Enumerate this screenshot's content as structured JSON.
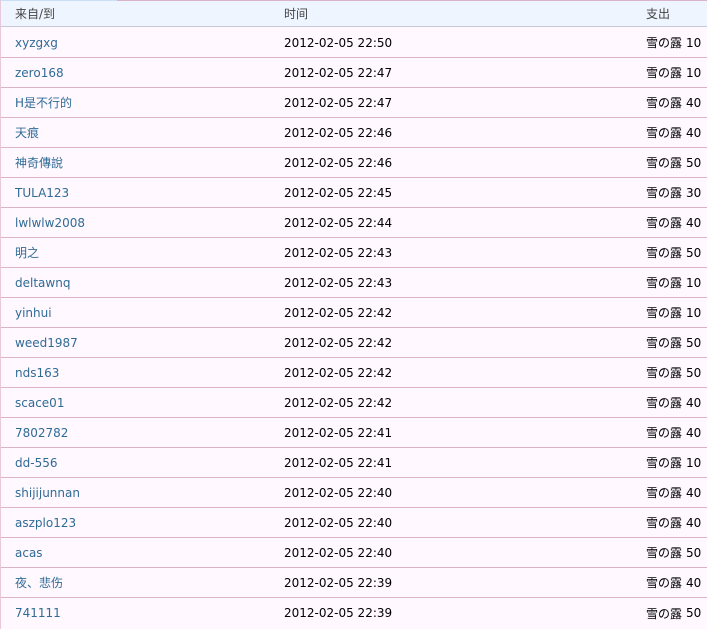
{
  "header": {
    "from": "来自/到",
    "time": "时间",
    "out": "支出"
  },
  "rows": [
    {
      "from": "xyzgxg",
      "time": "2012-02-05 22:50",
      "item": "雪の露",
      "amount": "10"
    },
    {
      "from": "zero168",
      "time": "2012-02-05 22:47",
      "item": "雪の露",
      "amount": "10"
    },
    {
      "from": "H是不行的",
      "time": "2012-02-05 22:47",
      "item": "雪の露",
      "amount": "40"
    },
    {
      "from": "天痕",
      "time": "2012-02-05 22:46",
      "item": "雪の露",
      "amount": "40"
    },
    {
      "from": "神奇傳說",
      "time": "2012-02-05 22:46",
      "item": "雪の露",
      "amount": "50"
    },
    {
      "from": "TULA123",
      "time": "2012-02-05 22:45",
      "item": "雪の露",
      "amount": "30"
    },
    {
      "from": "lwlwlw2008",
      "time": "2012-02-05 22:44",
      "item": "雪の露",
      "amount": "40"
    },
    {
      "from": "明之",
      "time": "2012-02-05 22:43",
      "item": "雪の露",
      "amount": "50"
    },
    {
      "from": "deltawnq",
      "time": "2012-02-05 22:43",
      "item": "雪の露",
      "amount": "10"
    },
    {
      "from": "yinhui",
      "time": "2012-02-05 22:42",
      "item": "雪の露",
      "amount": "10"
    },
    {
      "from": "weed1987",
      "time": "2012-02-05 22:42",
      "item": "雪の露",
      "amount": "50"
    },
    {
      "from": "nds163",
      "time": "2012-02-05 22:42",
      "item": "雪の露",
      "amount": "50"
    },
    {
      "from": "scace01",
      "time": "2012-02-05 22:42",
      "item": "雪の露",
      "amount": "40"
    },
    {
      "from": "7802782",
      "time": "2012-02-05 22:41",
      "item": "雪の露",
      "amount": "40"
    },
    {
      "from": "dd-556",
      "time": "2012-02-05 22:41",
      "item": "雪の露",
      "amount": "10"
    },
    {
      "from": "shijijunnan",
      "time": "2012-02-05 22:40",
      "item": "雪の露",
      "amount": "40"
    },
    {
      "from": "aszplo123",
      "time": "2012-02-05 22:40",
      "item": "雪の露",
      "amount": "40"
    },
    {
      "from": "acas",
      "time": "2012-02-05 22:40",
      "item": "雪の露",
      "amount": "50"
    },
    {
      "from": "夜、悲伤",
      "time": "2012-02-05 22:39",
      "item": "雪の露",
      "amount": "40"
    },
    {
      "from": "741111",
      "time": "2012-02-05 22:39",
      "item": "雪の露",
      "amount": "50"
    }
  ]
}
